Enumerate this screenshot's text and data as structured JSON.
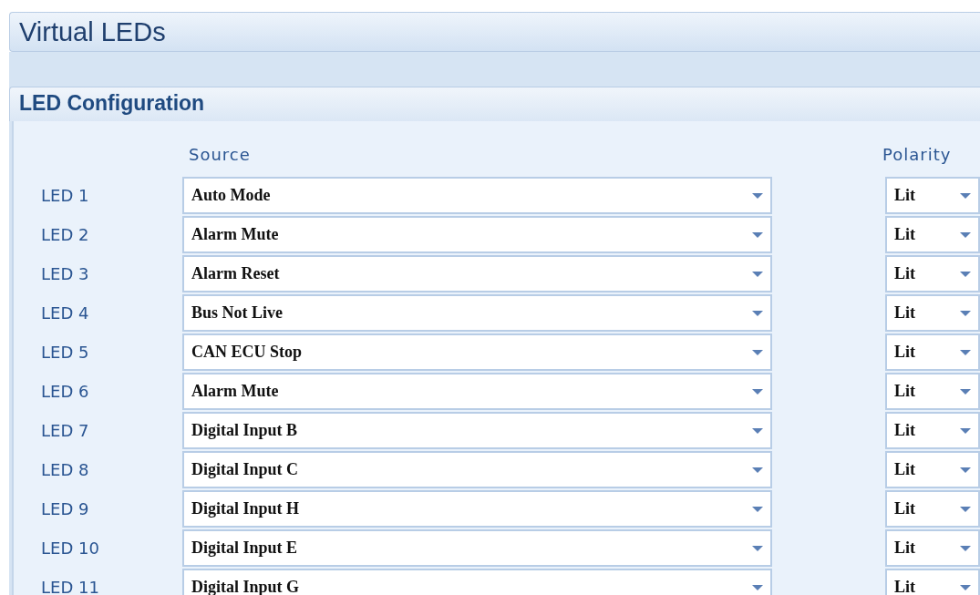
{
  "page_title": "Virtual LEDs",
  "section": {
    "title": "LED Configuration",
    "columns": {
      "source": "Source",
      "polarity": "Polarity"
    },
    "rows": [
      {
        "label": "LED 1",
        "source": "Auto Mode",
        "polarity": "Lit"
      },
      {
        "label": "LED 2",
        "source": "Alarm Mute",
        "polarity": "Lit"
      },
      {
        "label": "LED 3",
        "source": "Alarm Reset",
        "polarity": "Lit"
      },
      {
        "label": "LED 4",
        "source": "Bus Not Live",
        "polarity": "Lit"
      },
      {
        "label": "LED 5",
        "source": "CAN ECU Stop",
        "polarity": "Lit"
      },
      {
        "label": "LED 6",
        "source": "Alarm Mute",
        "polarity": "Lit"
      },
      {
        "label": "LED 7",
        "source": "Digital Input B",
        "polarity": "Lit"
      },
      {
        "label": "LED 8",
        "source": "Digital Input C",
        "polarity": "Lit"
      },
      {
        "label": "LED 9",
        "source": "Digital Input H",
        "polarity": "Lit"
      },
      {
        "label": "LED 10",
        "source": "Digital Input E",
        "polarity": "Lit"
      },
      {
        "label": "LED 11",
        "source": "Digital Input G",
        "polarity": "Lit"
      }
    ]
  }
}
